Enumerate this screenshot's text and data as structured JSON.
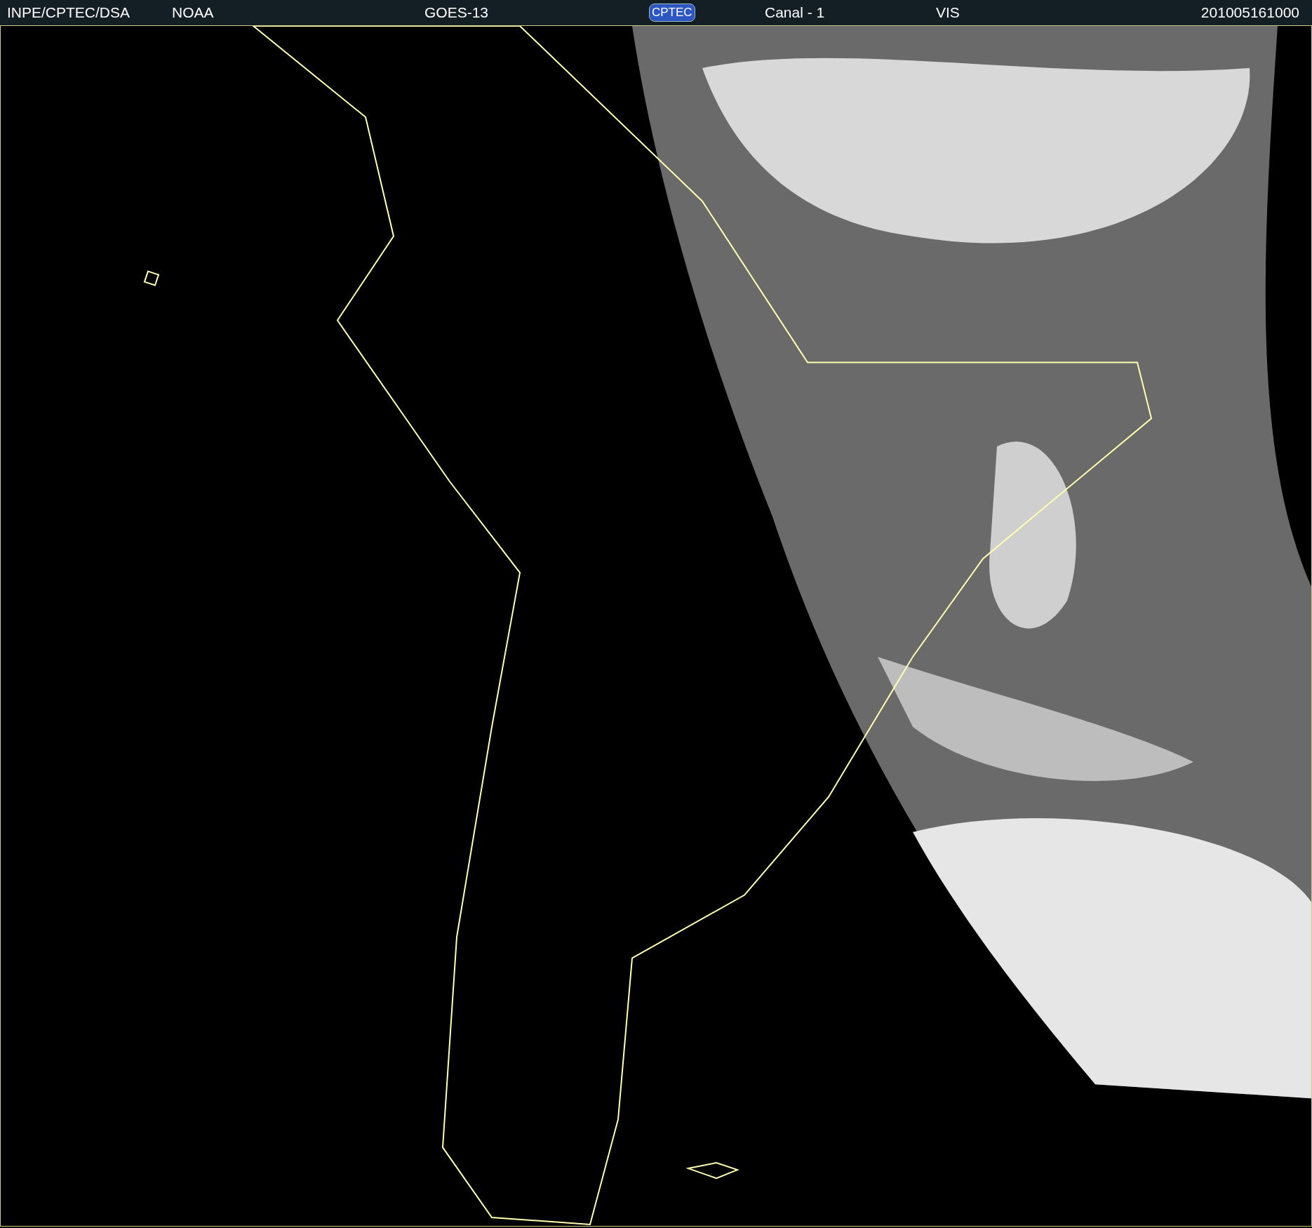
{
  "header": {
    "items": [
      {
        "kind": "text",
        "text": "INPE/CPTEC/DSA"
      },
      {
        "kind": "text",
        "text": "NOAA"
      },
      {
        "kind": "text",
        "text": "GOES-13"
      },
      {
        "kind": "logo",
        "text": "CPTEC"
      },
      {
        "kind": "text",
        "text": "Canal - 1"
      },
      {
        "kind": "text",
        "text": "VIS"
      },
      {
        "kind": "text",
        "text": "201005161000"
      }
    ]
  }
}
